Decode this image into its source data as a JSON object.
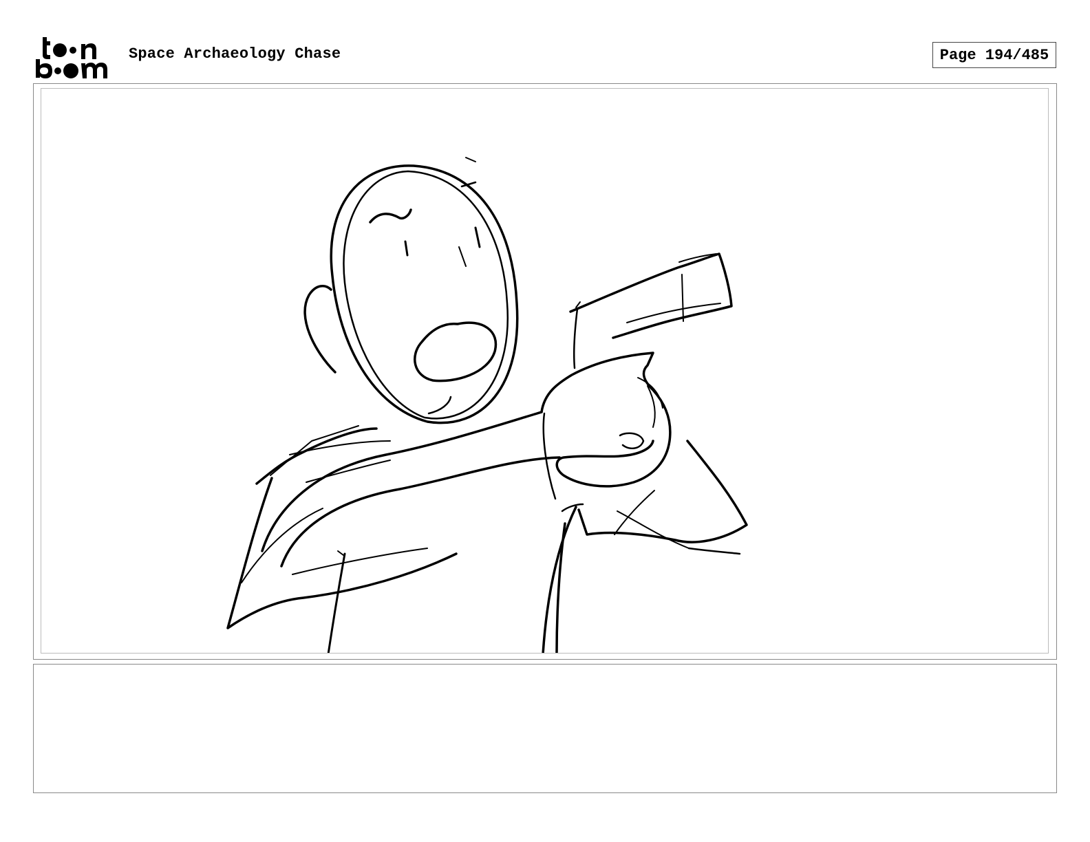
{
  "header": {
    "logo_alt": "toon boom",
    "project_title": "Space Archaeology Chase",
    "page_label": "Page 194/485"
  },
  "panel": {
    "drawing": "pencil-sketch"
  },
  "notes": {
    "text": ""
  },
  "colors": {
    "ink": "#000000",
    "border": "#888888",
    "background": "#ffffff"
  }
}
